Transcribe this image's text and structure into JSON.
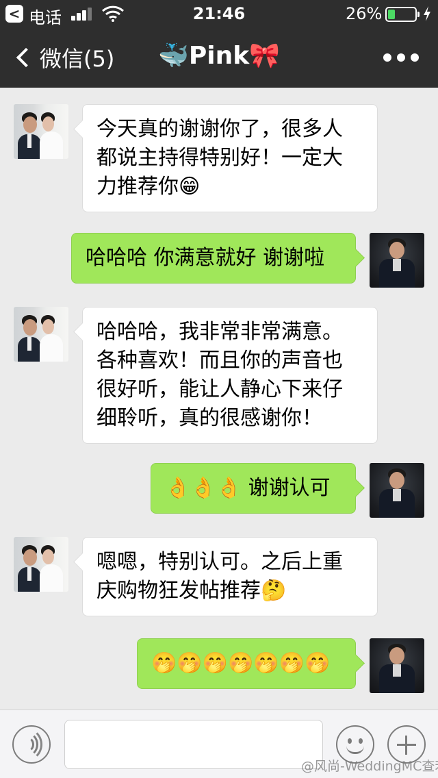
{
  "status_bar": {
    "back_app_glyph": "<",
    "carrier": "电话",
    "time": "21:46",
    "battery_percent": "26%",
    "battery_level": 0.26,
    "battery_color": "#4cd964"
  },
  "nav": {
    "back_label": "微信(5)",
    "title": "🐳Pink🎀",
    "more_icon": "more-dots-icon"
  },
  "messages": [
    {
      "direction": "in",
      "sender": "bride-and-groom",
      "text": "今天真的谢谢你了，很多人\n都说主持得特别好！一定大\n力推荐你😁"
    },
    {
      "direction": "out",
      "sender": "host",
      "text": "哈哈哈 你满意就好 谢谢啦"
    },
    {
      "direction": "in",
      "sender": "bride-and-groom",
      "text": "哈哈哈，我非常非常满意。\n各种喜欢！而且你的声音也\n很好听，能让人静心下来仔\n细聆听，真的很感谢你！"
    },
    {
      "direction": "out",
      "sender": "host",
      "text": "👌👌👌 谢谢认可"
    },
    {
      "direction": "in",
      "sender": "bride-and-groom",
      "text": "嗯嗯，特别认可。之后上重\n庆购物狂发帖推荐🤔"
    },
    {
      "direction": "out",
      "sender": "host",
      "text": "🤭🤭🤭🤭🤭🤭🤭"
    }
  ],
  "input_bar": {
    "voice_icon": "voice-icon",
    "emoji_icon": "emoji-icon",
    "plus_icon": "plus-icon",
    "input_value": ""
  },
  "watermark": "@风尚-WeddingMC查若",
  "colors": {
    "header_bg": "#2e2e2e",
    "chat_bg": "#ebebeb",
    "outgoing_bubble": "#a0e75a",
    "incoming_bubble": "#ffffff"
  }
}
